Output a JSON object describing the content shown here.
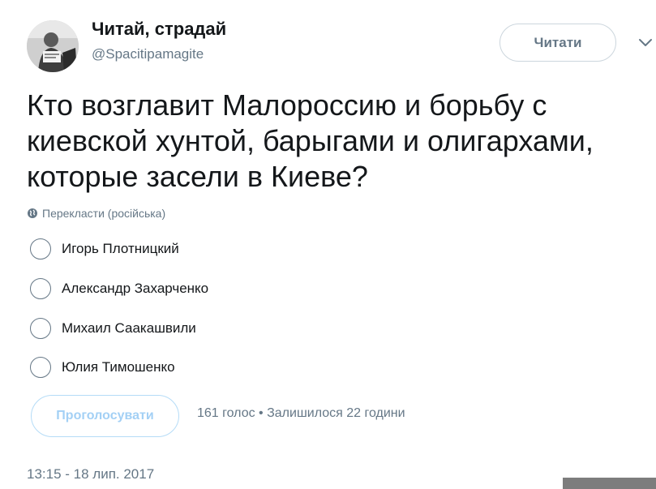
{
  "author": {
    "display_name": "Читай, страдай",
    "handle": "@Spacitipamagite"
  },
  "follow_button": {
    "label": "Читати"
  },
  "tweet": {
    "line1": "Кто возглавит Малороссию и борьбу с",
    "line2": "киевской хунтой, барыгами и олигархами,",
    "line3": "которые засели в Киеве?"
  },
  "translate": {
    "label": "Перекласти (російська)"
  },
  "poll": {
    "options": [
      {
        "label": "Игорь Плотницкий"
      },
      {
        "label": "Александр Захарченко"
      },
      {
        "label": "Михаил Саакашвили"
      },
      {
        "label": "Юлия Тимошенко"
      }
    ],
    "vote_button": "Проголосувати",
    "votes": "161 голос",
    "separator": "•",
    "time_left": "Залишилося 22 години"
  },
  "timestamp": "13:15 - 18 лип. 2017",
  "icons": {
    "chevron": "chevron-down-icon",
    "globe": "globe-icon",
    "avatar": "avatar"
  },
  "colors": {
    "text": "#14171a",
    "secondary": "#657786",
    "vote_disabled_border": "#b5dcf7",
    "vote_disabled_text": "#a3d0f5"
  }
}
